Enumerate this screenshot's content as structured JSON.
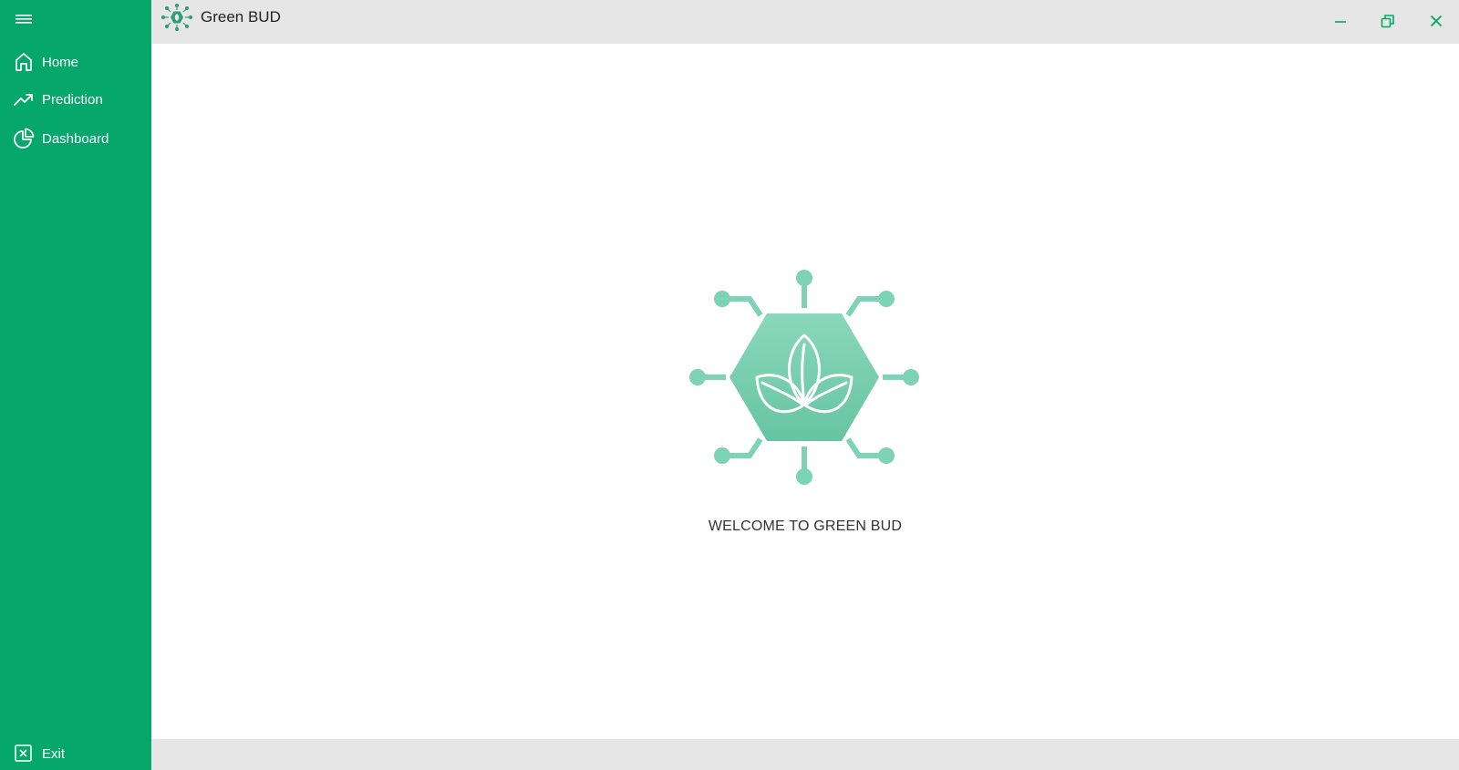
{
  "app": {
    "title": "Green BUD",
    "accent_color": "#05a86a",
    "logo_color": "#7dd3b5"
  },
  "sidebar": {
    "menu_icon": "hamburger-icon",
    "items": [
      {
        "label": "Home",
        "icon": "home-icon"
      },
      {
        "label": "Prediction",
        "icon": "trending-up-icon"
      },
      {
        "label": "Dashboard",
        "icon": "pie-chart-icon"
      }
    ],
    "exit": {
      "label": "Exit",
      "icon": "close-box-icon"
    }
  },
  "window_controls": {
    "minimize_icon": "minimize-icon",
    "restore_icon": "restore-icon",
    "close_icon": "close-icon"
  },
  "main": {
    "welcome_text": "WELCOME TO GREEN BUD"
  }
}
